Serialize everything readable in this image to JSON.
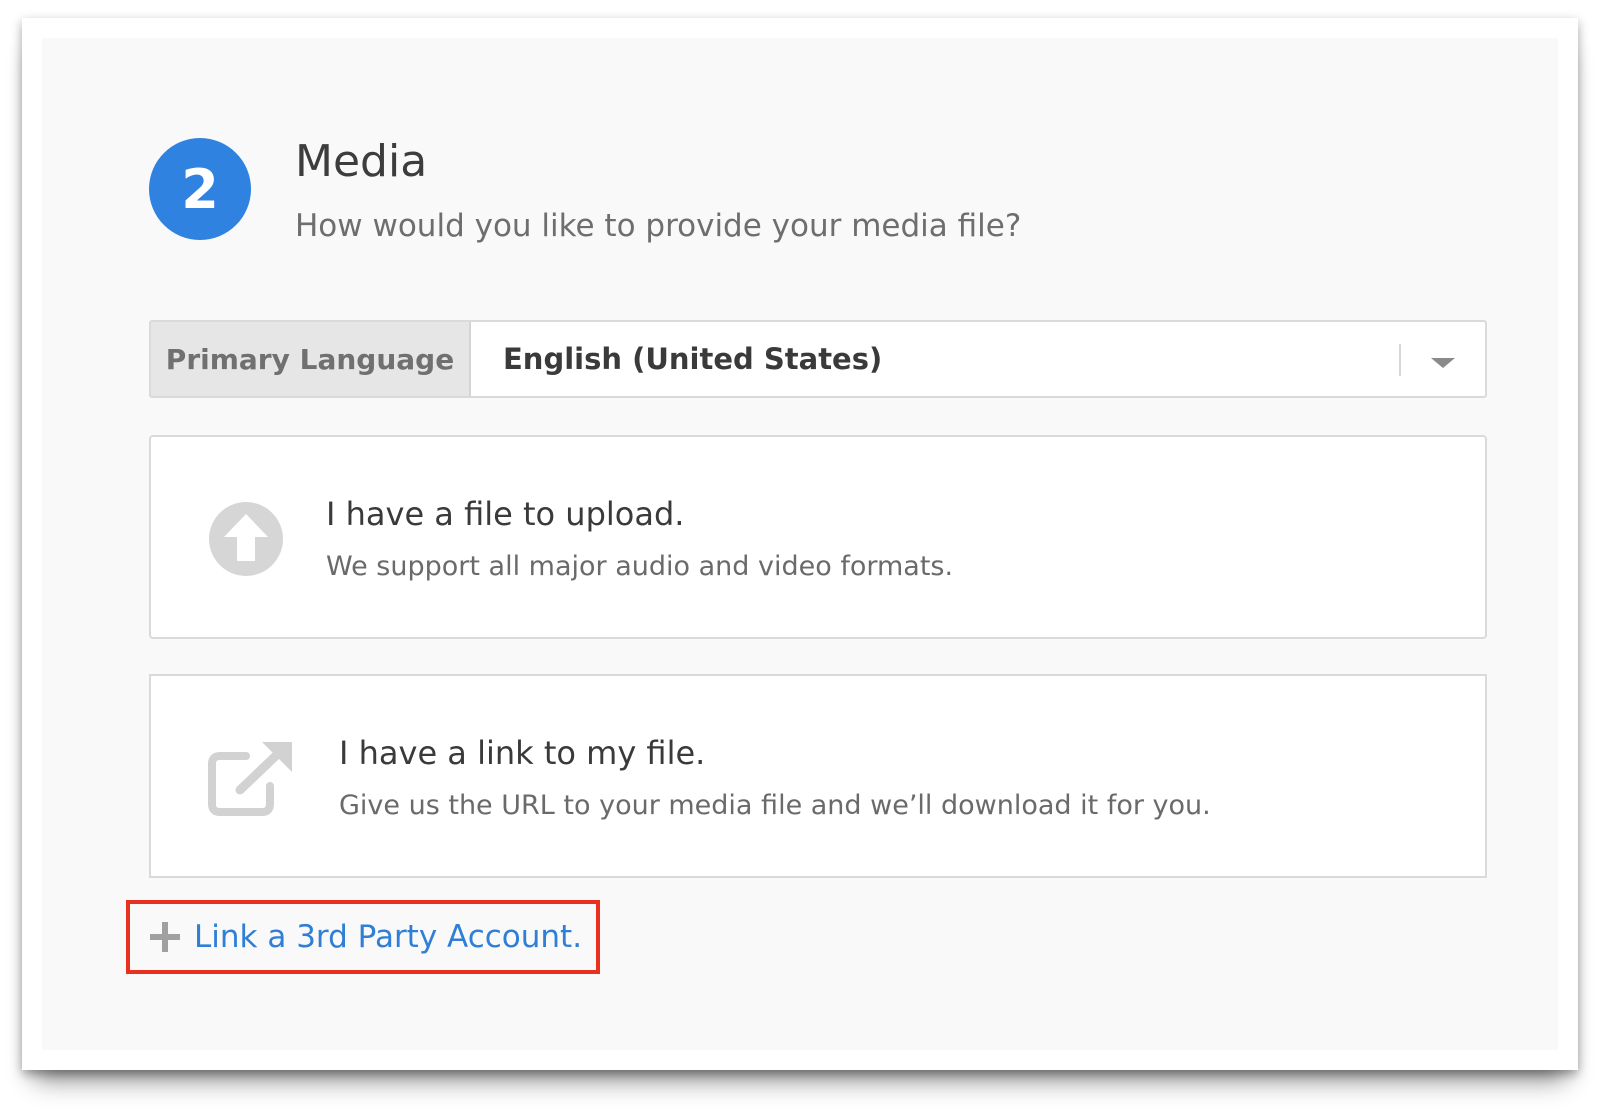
{
  "section": {
    "step_number": "2",
    "title": "Media",
    "subtitle": "How would you like to provide your media file?"
  },
  "language": {
    "label": "Primary Language",
    "selected": "English (United States)"
  },
  "options": [
    {
      "icon": "upload-arrow-icon",
      "title": "I have a file to upload.",
      "description": "We support all major audio and video formats."
    },
    {
      "icon": "external-link-icon",
      "title": "I have a link to my file.",
      "description": "Give us the URL to your media file and we’ll download it for you."
    }
  ],
  "third_party": {
    "icon": "plus-icon",
    "label": "Link a 3rd Party Account."
  },
  "colors": {
    "accent": "#2f82e0",
    "link": "#2f7fd6",
    "highlight_box": "#e8321f"
  }
}
